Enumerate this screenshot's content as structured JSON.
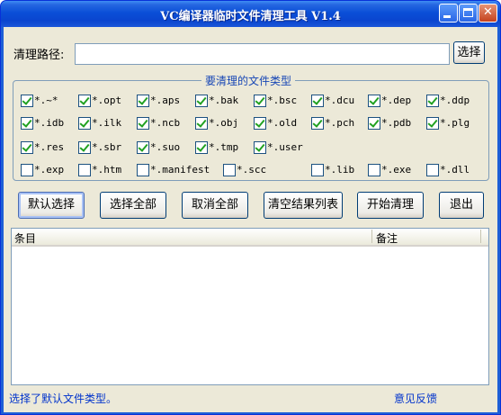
{
  "window": {
    "title": "VC编译器临时文件清理工具 V1.4"
  },
  "path": {
    "label": "清理路径:",
    "value": "",
    "browse_label": "选择"
  },
  "filetypes": {
    "group_title": "要清理的文件类型",
    "items": [
      {
        "label": "*.~*",
        "checked": true
      },
      {
        "label": "*.opt",
        "checked": true
      },
      {
        "label": "*.aps",
        "checked": true
      },
      {
        "label": "*.bak",
        "checked": true
      },
      {
        "label": "*.bsc",
        "checked": true
      },
      {
        "label": "*.dcu",
        "checked": true
      },
      {
        "label": "*.dep",
        "checked": true
      },
      {
        "label": "*.ddp",
        "checked": true
      },
      {
        "label": "*.idb",
        "checked": true
      },
      {
        "label": "*.ilk",
        "checked": true
      },
      {
        "label": "*.ncb",
        "checked": true
      },
      {
        "label": "*.obj",
        "checked": true
      },
      {
        "label": "*.old",
        "checked": true
      },
      {
        "label": "*.pch",
        "checked": true
      },
      {
        "label": "*.pdb",
        "checked": true
      },
      {
        "label": "*.plg",
        "checked": true
      },
      {
        "label": "*.res",
        "checked": true
      },
      {
        "label": "*.sbr",
        "checked": true
      },
      {
        "label": "*.suo",
        "checked": true
      },
      {
        "label": "*.tmp",
        "checked": true
      },
      {
        "label": "*.user",
        "checked": true
      },
      {
        "label": "*.exp",
        "checked": false
      },
      {
        "label": "*.htm",
        "checked": false
      },
      {
        "label": "*.manifest",
        "checked": false
      },
      {
        "label": "*.scc",
        "checked": false
      },
      {
        "label": "*.lib",
        "checked": false
      },
      {
        "label": "*.exe",
        "checked": false
      },
      {
        "label": "*.dll",
        "checked": false
      }
    ]
  },
  "actions": {
    "default_select": "默认选择",
    "select_all": "选择全部",
    "deselect_all": "取消全部",
    "clear_list": "清空结果列表",
    "start_clean": "开始清理",
    "exit": "退出"
  },
  "results": {
    "columns": [
      "条目",
      "备注"
    ],
    "rows": []
  },
  "status": {
    "message": "选择了默认文件类型。",
    "feedback_link": "意见反馈"
  }
}
